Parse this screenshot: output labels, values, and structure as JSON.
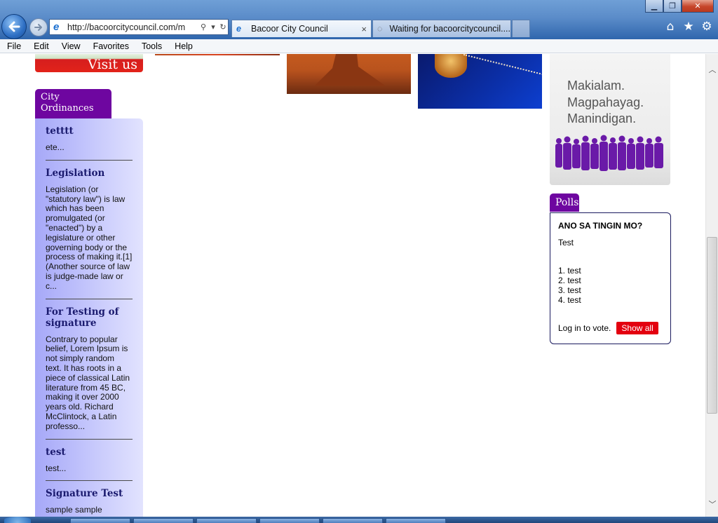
{
  "browser": {
    "address_url": "http://bacoorcitycouncil.com/m",
    "active_tab_title": "Bacoor City Council",
    "inactive_tab_title": "Waiting for bacoorcitycouncil....",
    "tab_close_glyph": "×"
  },
  "menubar": {
    "items": [
      "File",
      "Edit",
      "View",
      "Favorites",
      "Tools",
      "Help"
    ]
  },
  "page": {
    "visit_banner_text": "Visit us",
    "ordinances": {
      "tab_label": "City Ordinances",
      "items": [
        {
          "title": "tetttt",
          "body": "ete..."
        },
        {
          "title": "Legislation",
          "body": "Legislation (or \"statutory law\") is law which has been promulgated (or \"enacted\") by a legislature or other governing body or the process of making it.[1] (Another source of law is judge-made law or c..."
        },
        {
          "title": "For Testing of signature",
          "body": "Contrary to popular belief, Lorem Ipsum is not simply random text. It has roots in a piece of classical Latin literature from 45 BC, making it over 2000 years old. Richard McClintock, a Latin professo..."
        },
        {
          "title": "test",
          "body": "test..."
        },
        {
          "title": "Signature Test",
          "body": "sample sample"
        }
      ]
    },
    "advert": {
      "slogan_lines": [
        "Makialam.",
        "Magpahayag.",
        "Manindigan."
      ]
    },
    "polls": {
      "tab_label": "Polls",
      "question": "ANO SA TINGIN MO?",
      "description": "Test",
      "options": [
        "1. test",
        "2. test",
        "3. test",
        "4. test"
      ],
      "login_text": "Log in to vote.",
      "show_all_label": "Show all"
    }
  },
  "colors": {
    "accent_purple": "#6e06a0",
    "show_all_red": "#e3000f",
    "ordinance_title": "#1a1a6e"
  }
}
